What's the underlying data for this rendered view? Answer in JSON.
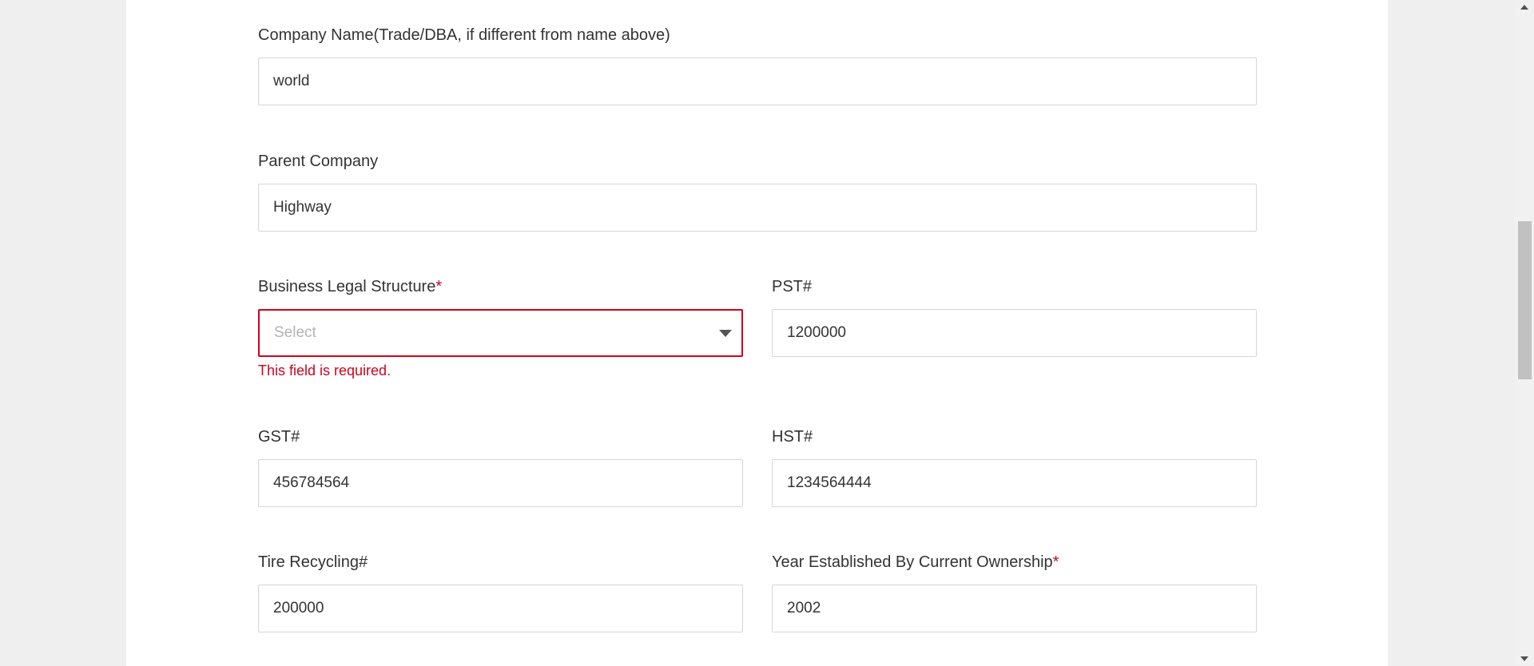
{
  "form": {
    "company_name": {
      "label": "Company Name(Trade/DBA, if different from name above)",
      "value": "world"
    },
    "parent_company": {
      "label": "Parent Company",
      "value": "Highway"
    },
    "business_legal_structure": {
      "label": "Business Legal Structure",
      "required_mark": "*",
      "placeholder": "Select",
      "error": "This field is required."
    },
    "pst": {
      "label": "PST#",
      "value": "1200000"
    },
    "gst": {
      "label": "GST#",
      "value": "456784564"
    },
    "hst": {
      "label": "HST#",
      "value": "1234564444"
    },
    "tire_recycling": {
      "label": "Tire Recycling#",
      "value": "200000"
    },
    "year_established": {
      "label": "Year Established By Current Ownership",
      "required_mark": "*",
      "value": "2002"
    }
  },
  "colors": {
    "error": "#d0021b",
    "border": "#d6d6d6",
    "background": "#efefef"
  },
  "icons": {
    "select_caret": "chevron-down-icon"
  }
}
